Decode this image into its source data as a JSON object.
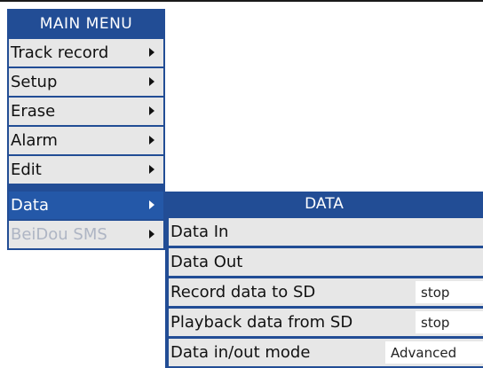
{
  "main_menu": {
    "title": "MAIN MENU",
    "items": [
      {
        "label": "Track record",
        "state": "normal"
      },
      {
        "label": "Setup",
        "state": "normal"
      },
      {
        "label": "Erase",
        "state": "normal"
      },
      {
        "label": "Alarm",
        "state": "normal"
      },
      {
        "label": "Edit",
        "state": "normal"
      },
      {
        "label": "Data",
        "state": "selected"
      },
      {
        "label": "BeiDou SMS",
        "state": "disabled"
      }
    ]
  },
  "data_menu": {
    "title": "DATA",
    "items": [
      {
        "label": "Data In",
        "value": null
      },
      {
        "label": "Data Out",
        "value": null
      },
      {
        "label": "Record data to SD",
        "value": "stop"
      },
      {
        "label": "Playback data from SD",
        "value": "stop"
      },
      {
        "label": "Data in/out mode",
        "value": "Advanced"
      }
    ]
  },
  "colors": {
    "menu_frame": "#224d95",
    "selected_item": "#2458a8",
    "item_background": "#e7e7e7",
    "disabled_text": "#aeb5c4"
  }
}
